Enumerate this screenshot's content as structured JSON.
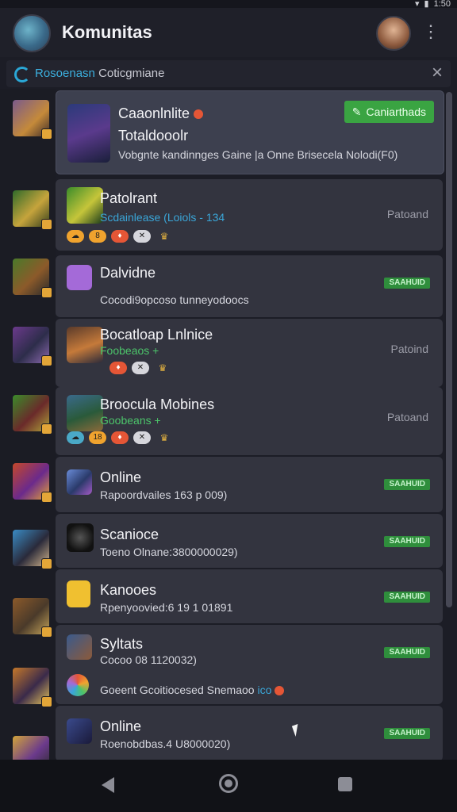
{
  "status": {
    "time": "1:50"
  },
  "header": {
    "title": "Komunitas"
  },
  "notice": {
    "prefix": "Rosoenasn",
    "text": "Coticgmiane"
  },
  "featured": {
    "name": "Caaonlnlite",
    "line2": "Totaldooolr",
    "line3": "Vobgnte kandinnges Gaine |a Onne Brisecela Nolodi(F0)",
    "button": "Caniarthads"
  },
  "rows": [
    {
      "name": "Patolrant",
      "sub": "Scdainlease (Loiols - 134",
      "state": "Patoand",
      "badges": [
        "8",
        "ℓ"
      ]
    },
    {
      "name": "Dalvidne",
      "sub": "Cocodi9opcoso tunneyodoocs",
      "pill": "SAAHUID"
    },
    {
      "name": "Bocatloap Lnlnice",
      "sub": "Foobeaos +",
      "state": "Patoind"
    },
    {
      "name": "Broocula Mobines",
      "sub": "Goobeans +",
      "state": "Patoand",
      "badges": [
        "18"
      ]
    },
    {
      "name": "Online",
      "sub": "Rapoordvailes 163 p 009)",
      "pill": "SAAHUID"
    },
    {
      "name": "Scanioce",
      "sub": "Toeno Olnane:3800000029)",
      "pill": "SAAHUID"
    },
    {
      "name": "Kanooes",
      "sub": "Rpenyoovied:6 19 1 01891",
      "pill": "SAAHUID"
    },
    {
      "name": "Syltats",
      "sub": "Cocoo 08 1120032)",
      "extra": "Goeent Gcoitiocesed Snemaoo",
      "extra_hl": "ico",
      "pill": "SAAHUID"
    },
    {
      "name": "Online",
      "sub": "Roenobdbas.4 U8000020)",
      "pill": "SAAHUID"
    }
  ],
  "colors": {
    "accent": "#3aa442",
    "bg": "#1c1d26",
    "card": "#33343f"
  }
}
